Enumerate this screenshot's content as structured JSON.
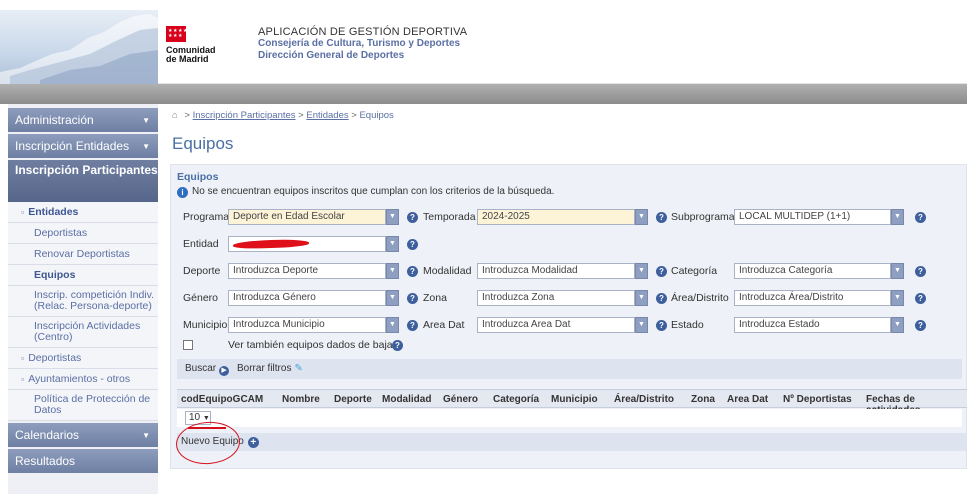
{
  "header": {
    "logo_line1": "Comunidad",
    "logo_line2": "de Madrid",
    "app_title": "APLICACIÓN DE GESTIÓN DEPORTIVA",
    "subtitle1": "Consejería de Cultura, Turismo y Deportes",
    "subtitle2": "Dirección General de Deportes"
  },
  "sidebar": {
    "administracion": "Administración",
    "inscripcion_entidades": "Inscripción Entidades",
    "inscripcion_participantes": "Inscripción Participantes",
    "entidades": "Entidades",
    "deportistas": "Deportistas",
    "renovar_deportistas": "Renovar Deportistas",
    "equipos": "Equipos",
    "inscrip_competicion": "Inscrip. competición Indiv.(Relac. Persona-deporte)",
    "inscripcion_actividades": "Inscripción Actividades (Centro)",
    "deportistas_top": "Deportistas",
    "ayuntamientos": "Ayuntamientos - otros",
    "politica": "Política de Protección de Datos",
    "calendarios": "Calendarios",
    "resultados": "Resultados"
  },
  "breadcrumb": {
    "home": "⌂",
    "item1": "Inscripción Participantes",
    "item2": "Entidades",
    "current": "Equipos"
  },
  "page_title": "Equipos",
  "panel": {
    "title": "Equipos",
    "notice": "No se encuentran equipos inscritos que cumplan con los criterios de la búsqueda."
  },
  "filters": {
    "programa_label": "Programa",
    "programa_value": "Deporte en Edad Escolar",
    "temporada_label": "Temporada",
    "temporada_value": "2024-2025",
    "subprograma_label": "Subprograma",
    "subprograma_value": "LOCAL MULTIDEP (1+1)",
    "entidad_label": "Entidad",
    "deporte_label": "Deporte",
    "deporte_placeholder": "Introduzca Deporte",
    "modalidad_label": "Modalidad",
    "modalidad_placeholder": "Introduzca Modalidad",
    "categoria_label": "Categoría",
    "categoria_placeholder": "Introduzca Categoría",
    "genero_label": "Género",
    "genero_placeholder": "Introduzca Género",
    "zona_label": "Zona",
    "zona_placeholder": "Introduzca Zona",
    "area_distrito_label": "Área/Distrito",
    "area_distrito_placeholder": "Introduzca Área/Distrito",
    "municipio_label": "Municipio",
    "municipio_placeholder": "Introduzca Municipio",
    "area_dat_label": "Area Dat",
    "area_dat_placeholder": "Introduzca Area Dat",
    "estado_label": "Estado",
    "estado_placeholder": "Introduzca Estado",
    "ver_baja": "Ver también equipos dados de baja"
  },
  "buttons": {
    "buscar": "Buscar",
    "borrar": "Borrar filtros",
    "nuevo_equipo": "Nuevo Equipo"
  },
  "table": {
    "columns": [
      "codEquipoGCAM",
      "Nombre",
      "Deporte",
      "Modalidad",
      "Género",
      "Categoría",
      "Municipio",
      "Área/Distrito",
      "Zona",
      "Area Dat",
      "Nº Deportistas",
      "Fechas de actividades"
    ],
    "page_size": "10"
  }
}
